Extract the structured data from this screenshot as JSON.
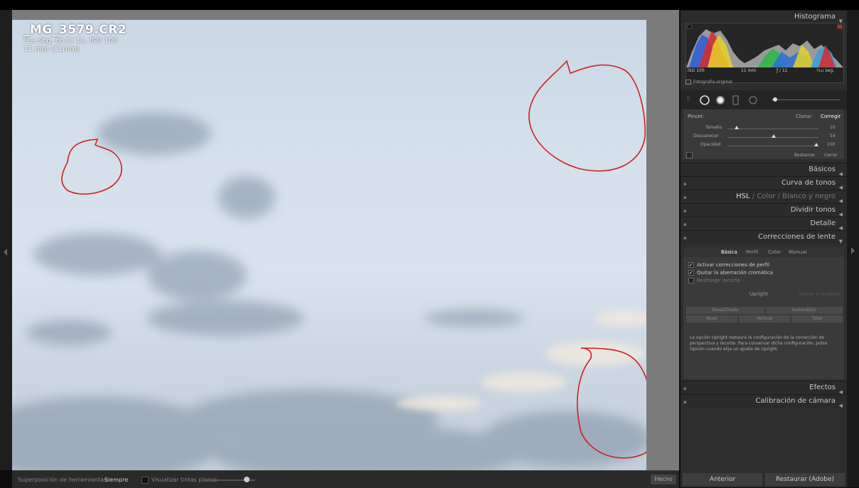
{
  "photo": {
    "filename": "_MG_3579.CR2",
    "exposure": "¹⁄₁₂₅ seg. en ƒ / 11, ISO 100",
    "focal": "11 mm (11mm)"
  },
  "histogram": {
    "title": "Histograma",
    "labels": [
      "ISO 100",
      "11 mm",
      "ƒ / 11",
      "¹⁄₁₂₅ seg."
    ],
    "original_photo": "Fotografía original"
  },
  "brush": {
    "label": "Pincel:",
    "clone": "Clonar",
    "heal": "Corregir",
    "size_label": "Tamaño",
    "size_value": "10",
    "feather_label": "Desvanecer",
    "feather_value": "54",
    "opacity_label": "Opacidad",
    "opacity_value": "100",
    "reset": "Restaurar",
    "close": "Cerrar"
  },
  "sections": {
    "basic": "Básicos",
    "tone_curve": "Curva de tonos",
    "hsl": "HSL",
    "color": "Color",
    "bw": "Blanco y negro",
    "split": "Dividir tonos",
    "detail": "Detalle",
    "lens": "Correcciones de lente",
    "effects": "Efectos",
    "calibration": "Calibración de cámara"
  },
  "lens": {
    "tabs": [
      "Básica",
      "Perfil",
      "Color",
      "Manual"
    ],
    "enable_profile": "Activar correcciones de perfil",
    "remove_ca": "Quitar la aberración cromática",
    "constrain": "Restringir recorte",
    "upright": "Upright",
    "reanalyze": "Volver a analizar",
    "off": "Desactivado",
    "auto": "Automático",
    "level": "Nivel",
    "vertical": "Vertical",
    "full": "Total",
    "description": "La opción Upright restaura la configuración de la corrección de perspectiva y recorte. Para conservar dicha configuración, pulse Opción cuando elija un ajuste de Upright."
  },
  "bottom": {
    "overlay_label": "Superposición de herramientas:",
    "overlay_value": "Siempre",
    "visualize": "Visualizar tintas planas",
    "done": "Hecho"
  },
  "footer": {
    "previous": "Anterior",
    "reset_adobe": "Restaurar (Adobe)"
  }
}
